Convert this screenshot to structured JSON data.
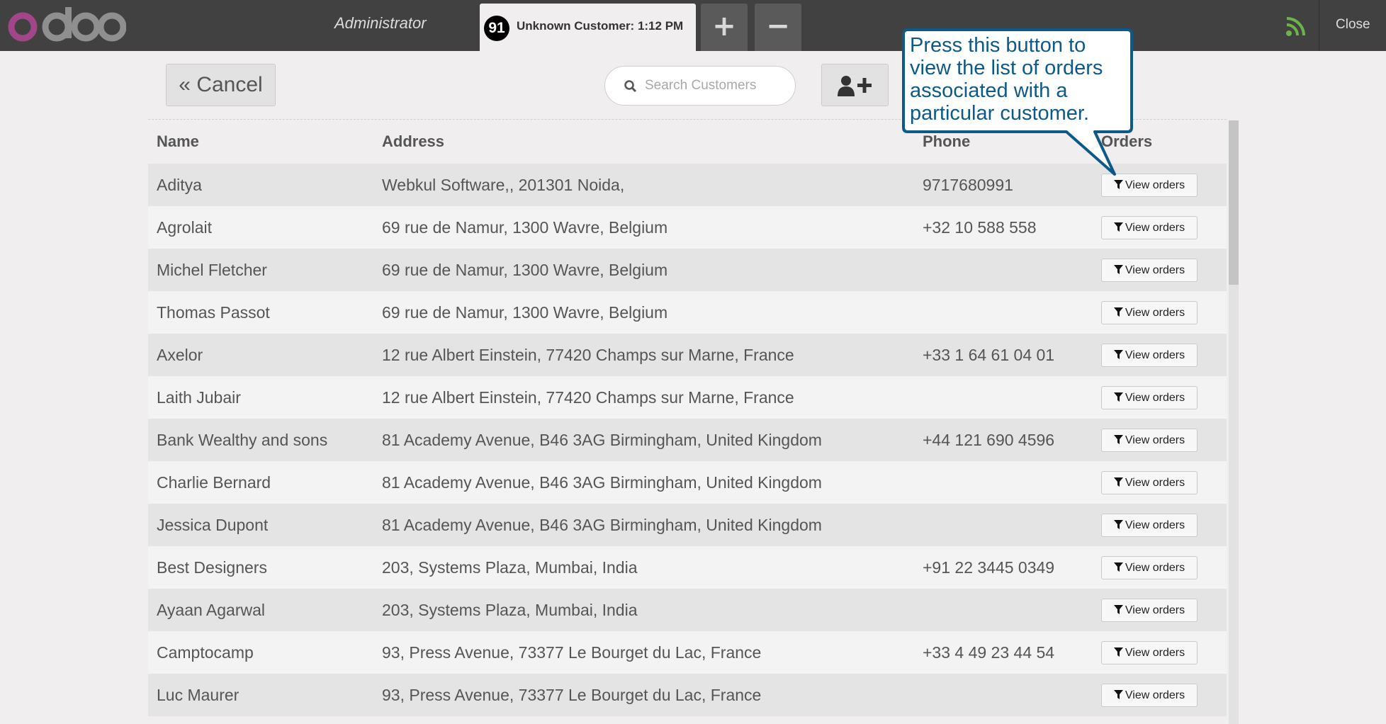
{
  "topbar": {
    "user_name": "Administrator",
    "order_number": "91",
    "order_label": "Unknown Customer: 1:12 PM",
    "add_order_label": "+",
    "remove_order_label": "−",
    "close_label": "Close",
    "colors": {
      "bar": "#414141",
      "logo_o": "#a24689",
      "logo_rest": "#8f8f8f",
      "rss": "#6cb44a"
    }
  },
  "actions": {
    "cancel_label": "Cancel",
    "cancel_icon": "double-chevron-left-icon",
    "search_placeholder": "Search Customers",
    "search_icon": "search-icon",
    "add_customer_icon": "add-user-icon"
  },
  "table": {
    "headers": {
      "name": "Name",
      "address": "Address",
      "phone": "Phone",
      "orders": "Orders"
    },
    "view_orders_label": "View orders",
    "rows": [
      {
        "name": "Aditya",
        "address": "Webkul Software,, 201301 Noida,",
        "phone": "9717680991"
      },
      {
        "name": "Agrolait",
        "address": "69 rue de Namur, 1300 Wavre, Belgium",
        "phone": "+32 10 588 558"
      },
      {
        "name": "Michel Fletcher",
        "address": "69 rue de Namur, 1300 Wavre, Belgium",
        "phone": ""
      },
      {
        "name": "Thomas Passot",
        "address": "69 rue de Namur, 1300 Wavre, Belgium",
        "phone": ""
      },
      {
        "name": "Axelor",
        "address": "12 rue Albert Einstein, 77420 Champs sur Marne, France",
        "phone": "+33 1 64 61 04 01"
      },
      {
        "name": "Laith Jubair",
        "address": "12 rue Albert Einstein, 77420 Champs sur Marne, France",
        "phone": ""
      },
      {
        "name": "Bank Wealthy and sons",
        "address": "81 Academy Avenue, B46 3AG Birmingham, United Kingdom",
        "phone": "+44 121 690 4596"
      },
      {
        "name": "Charlie Bernard",
        "address": "81 Academy Avenue, B46 3AG Birmingham, United Kingdom",
        "phone": ""
      },
      {
        "name": "Jessica Dupont",
        "address": "81 Academy Avenue, B46 3AG Birmingham, United Kingdom",
        "phone": ""
      },
      {
        "name": "Best Designers",
        "address": "203, Systems Plaza, Mumbai, India",
        "phone": "+91 22 3445 0349"
      },
      {
        "name": "Ayaan Agarwal",
        "address": "203, Systems Plaza, Mumbai, India",
        "phone": ""
      },
      {
        "name": "Camptocamp",
        "address": "93, Press Avenue, 73377 Le Bourget du Lac, France",
        "phone": "+33 4 49 23 44 54"
      },
      {
        "name": "Luc Maurer",
        "address": "93, Press Avenue, 73377 Le Bourget du Lac, France",
        "phone": ""
      }
    ]
  },
  "callout": {
    "text": "Press this button to view the list of orders associated with a particular customer.",
    "color": "#0d5a88"
  }
}
